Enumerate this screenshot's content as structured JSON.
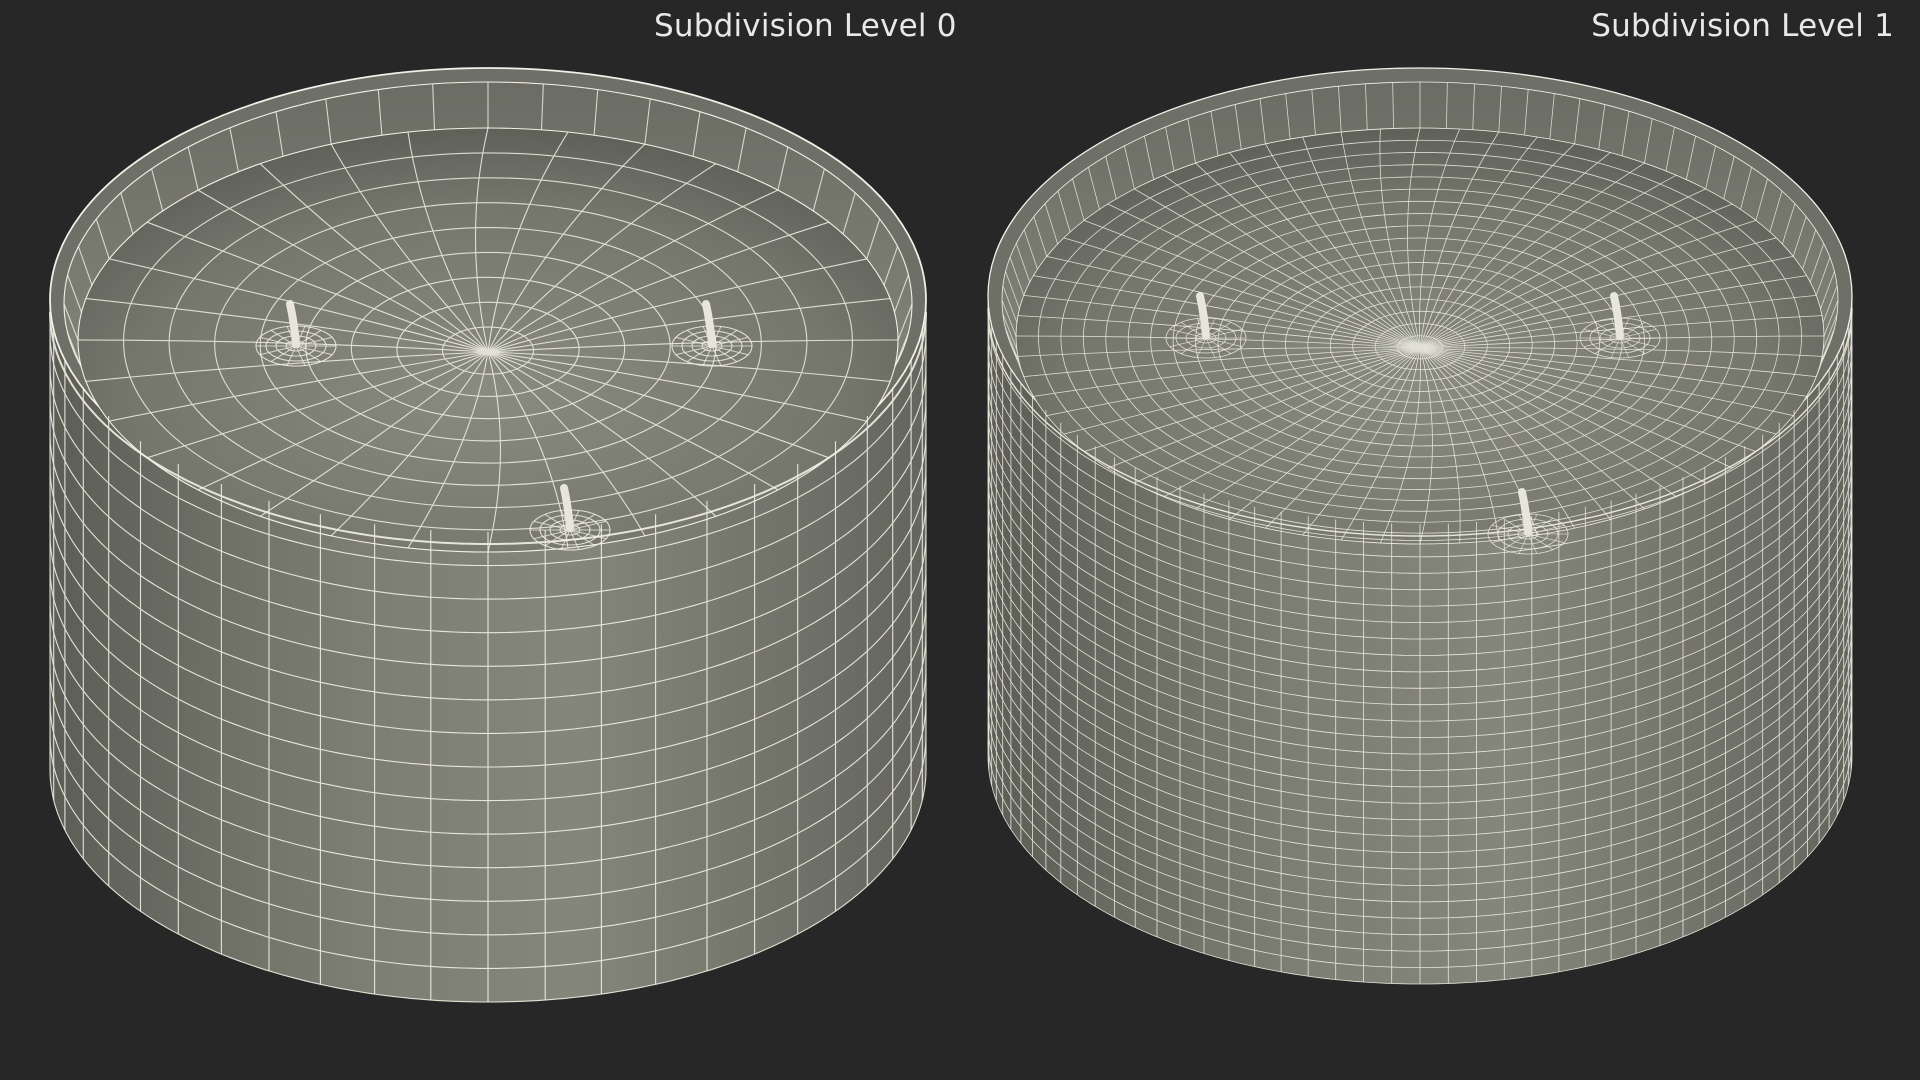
{
  "views": [
    {
      "label": "Subdivision Level 0",
      "subdivision_level": 0,
      "wick_count": 3
    },
    {
      "label": "Subdivision Level 1",
      "subdivision_level": 1,
      "wick_count": 3
    }
  ],
  "colors": {
    "background": "#272727",
    "surface_light": "#8b8b80",
    "surface_dark": "#55564f",
    "wire": "#f3f1e6",
    "label_text": "#e8e8e8"
  }
}
